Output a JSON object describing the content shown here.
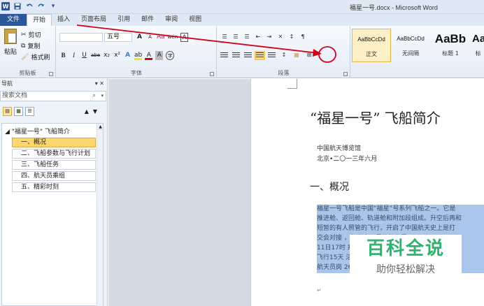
{
  "window": {
    "title": "福星一号.docx - Microsoft Word",
    "word_logo": "W"
  },
  "quick_access": {
    "save_icon": "save-icon",
    "undo_icon": "undo-icon",
    "redo_icon": "redo-icon",
    "customize_glyph": "▾"
  },
  "tabs": [
    {
      "label": "文件"
    },
    {
      "label": "开始"
    },
    {
      "label": "插入"
    },
    {
      "label": "页面布局"
    },
    {
      "label": "引用"
    },
    {
      "label": "邮件"
    },
    {
      "label": "审阅"
    },
    {
      "label": "视图"
    }
  ],
  "ribbon": {
    "clipboard": {
      "label": "剪贴板",
      "paste": "粘贴",
      "cut": "剪切",
      "copy": "复制",
      "format_painter": "格式刷"
    },
    "font": {
      "label": "字体",
      "font_name": "",
      "font_size": "五号",
      "grow": "A",
      "shrink": "A",
      "clear": "Aa",
      "phonetic": "wén",
      "char_border": "A",
      "bold": "B",
      "italic": "I",
      "underline": "U",
      "strike": "abe",
      "subscript": "x₂",
      "superscript": "x²",
      "text_effect": "A",
      "highlight": "ab",
      "font_color": "A",
      "char_shading": "A",
      "enclose": "字"
    },
    "paragraph": {
      "label": "段落",
      "bullets": "☰",
      "numbering": "☰",
      "multilevel": "☰",
      "decrease_indent": "⇤",
      "increase_indent": "⇥",
      "chinese_layout": "✕",
      "sort": "↕",
      "show_marks": "¶",
      "line_spacing": "↕",
      "shading": "▦",
      "borders": "⊞"
    },
    "styles": [
      {
        "sample": "AaBbCcDd",
        "name": "正文"
      },
      {
        "sample": "AaBbCcDd",
        "name": "无间隔"
      },
      {
        "sample": "AaBb",
        "name": "标题 1"
      },
      {
        "sample": "Aa",
        "name": "标"
      }
    ],
    "highlight_color": "#d0021b"
  },
  "nav_pane": {
    "title": "导航",
    "close_glyph": "▾ ✕",
    "search_placeholder": "搜索文档",
    "search_icon": "search-icon",
    "root": "\"福星一号\" 飞船简介",
    "items": [
      {
        "label": "一、概况",
        "selected": true
      },
      {
        "label": "二、飞船参数与飞行计划",
        "selected": false
      },
      {
        "label": "三、飞船任务",
        "selected": false
      },
      {
        "label": "四、航天员乘组",
        "selected": false
      },
      {
        "label": "五、精彩时刻",
        "selected": false
      }
    ]
  },
  "document": {
    "title": "“福星一号” 飞船简介",
    "org": "中国航天博览馆",
    "date": "北京•二〇一三年六月",
    "heading": "一、概况",
    "body_lines": [
      "福星一号飞船是中国“福星”号系列飞船之一。它是",
      "推进舱、返回舱、轨道舱和附加段组成。升空后再和",
      "短暂的有人照管的飞行，开启了中国航天史上是打",
      "交会对接                          ，与天宫一号目标卫星",
      "11日17时                          乘坐福星一号载人飞船进型",
      "飞行15天                          活动。",
      "航天员岗                          26日"
    ]
  },
  "watermark": {
    "title": "百科全说",
    "subtitle": "助你轻松解决"
  }
}
